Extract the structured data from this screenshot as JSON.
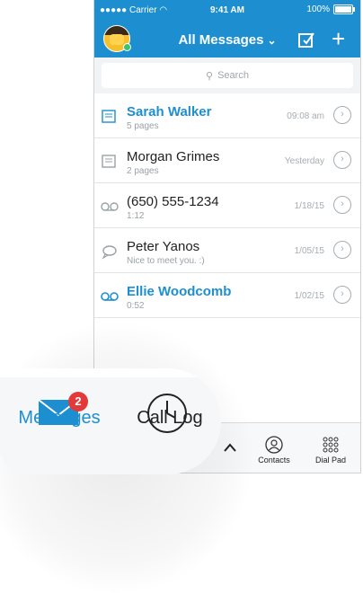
{
  "status": {
    "carrier": "Carrier",
    "time": "9:41 AM",
    "battery": "100%"
  },
  "header": {
    "title": "All Messages"
  },
  "search": {
    "placeholder": "Search"
  },
  "messages": [
    {
      "name": "Sarah Walker",
      "sub": "5 pages",
      "date": "09:08 am",
      "type": "fax",
      "unread": true
    },
    {
      "name": "Morgan Grimes",
      "sub": "2 pages",
      "date": "Yesterday",
      "type": "fax",
      "unread": false
    },
    {
      "name": "(650) 555-1234",
      "sub": "1:12",
      "date": "1/18/15",
      "type": "voicemail",
      "unread": false
    },
    {
      "name": "Peter Yanos",
      "sub": "Nice to meet you. :)",
      "date": "1/05/15",
      "type": "text",
      "unread": false
    },
    {
      "name": "Ellie Woodcomb",
      "sub": "0:52",
      "date": "1/02/15",
      "type": "voicemail",
      "unread": true
    }
  ],
  "tabs": {
    "messages": "Messages",
    "messages_badge": "2",
    "call_log": "Call Log",
    "contacts": "Contacts",
    "dial_pad": "Dial Pad"
  },
  "colors": {
    "accent": "#1d8fd0",
    "badge": "#e23a3a"
  }
}
